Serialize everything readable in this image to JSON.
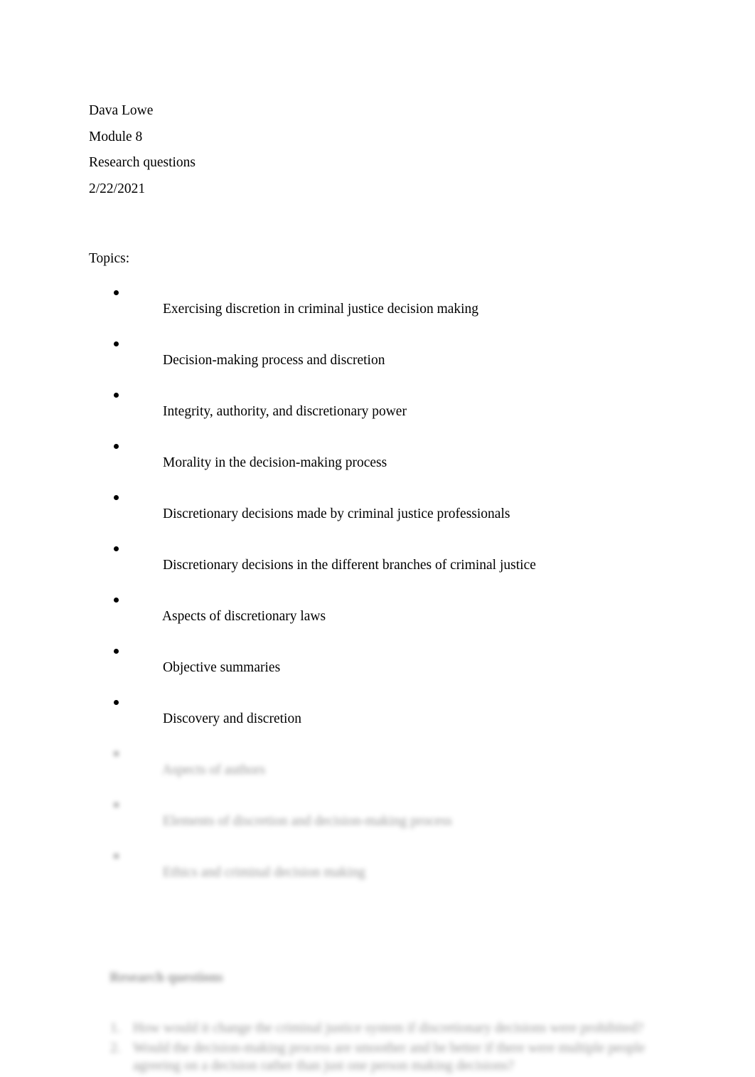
{
  "document": {
    "background_color": "#ffffff",
    "text_color": "#000000",
    "header": {
      "author": "Dava Lowe",
      "module": "Module 8",
      "assignment": "Research questions",
      "date": "2/22/2021"
    },
    "topics_section": {
      "label": "Topics:",
      "items": [
        {
          "text": "Exercising discretion in criminal justice decision making",
          "obscured": false
        },
        {
          "text": "Decision-making process and discretion",
          "obscured": false
        },
        {
          "text": "Integrity, authority, and discretionary power",
          "obscured": false
        },
        {
          "text": "Morality in the decision-making process",
          "obscured": false
        },
        {
          "text": "Discretionary decisions made by criminal justice professionals",
          "obscured": false
        },
        {
          "text": "Discretionary decisions in the different branches of criminal justice",
          "obscured": false
        },
        {
          "text": "Aspects of discretionary laws",
          "obscured": false
        },
        {
          "text": "Objective summaries",
          "obscured": false
        },
        {
          "text": "Discovery and discretion",
          "obscured": false
        },
        {
          "text": "Aspects of authors",
          "obscured": true
        },
        {
          "text": "Elements of discretion and decision-making process",
          "obscured": true
        },
        {
          "text": "Ethics and criminal decision making",
          "obscured": true
        }
      ]
    },
    "research_questions_section": {
      "heading": "Research questions",
      "items": [
        {
          "text": "How would it change the criminal justice system if discretionary decisions were prohibited?",
          "obscured": true
        },
        {
          "text": "Would the decision-making process are smoother and be better if there were multiple people agreeing on a decision rather than just one person making decisions?",
          "obscured": true
        }
      ]
    }
  }
}
